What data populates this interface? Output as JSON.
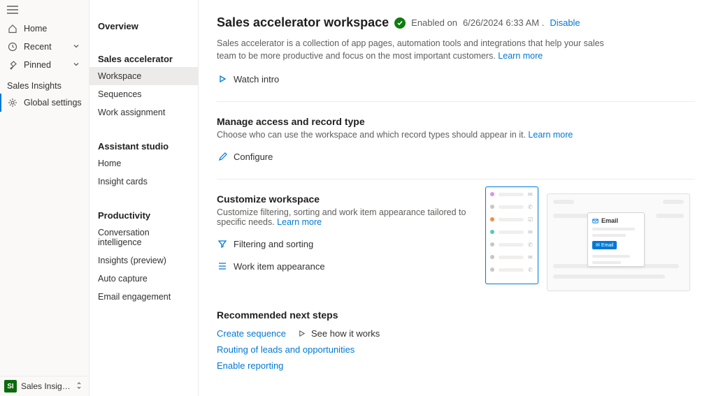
{
  "rail": {
    "items": [
      {
        "label": "Home",
        "icon": "home"
      },
      {
        "label": "Recent",
        "icon": "clock",
        "expandable": true
      },
      {
        "label": "Pinned",
        "icon": "pin",
        "expandable": true
      }
    ],
    "group_title": "Sales Insights",
    "group_items": [
      {
        "label": "Global settings",
        "icon": "gear"
      }
    ],
    "footer": {
      "badge": "SI",
      "label": "Sales Insights sett…"
    }
  },
  "nav2": {
    "overview": "Overview",
    "sections": [
      {
        "title": "Sales accelerator",
        "items": [
          "Workspace",
          "Sequences",
          "Work assignment"
        ],
        "active": "Workspace"
      },
      {
        "title": "Assistant studio",
        "items": [
          "Home",
          "Insight cards"
        ]
      },
      {
        "title": "Productivity",
        "items": [
          "Conversation intelligence",
          "Insights (preview)",
          "Auto capture",
          "Email engagement"
        ]
      }
    ]
  },
  "main": {
    "title": "Sales accelerator workspace",
    "status_enabled_prefix": "Enabled on",
    "status_date": "6/26/2024 6:33 AM .",
    "disable_label": "Disable",
    "description": "Sales accelerator is a collection of app pages, automation tools and integrations that help your sales team to be more productive and focus on the most important customers.",
    "learn_more": "Learn more",
    "watch_intro": "Watch intro",
    "section_access": {
      "title": "Manage access and record type",
      "desc": "Choose who can use the workspace and which record types should appear in it.",
      "configure": "Configure"
    },
    "section_customize": {
      "title": "Customize workspace",
      "desc": "Customize filtering, sorting and work item appearance tailored to specific needs.",
      "filtering": "Filtering and sorting",
      "workitem": "Work item appearance",
      "email_label": "Email",
      "email_button": "Email"
    },
    "section_next": {
      "title": "Recommended next steps",
      "create_sequence": "Create sequence",
      "see_how": "See how it works",
      "routing": "Routing of leads and opportunities",
      "enable_reporting": "Enable reporting"
    }
  }
}
